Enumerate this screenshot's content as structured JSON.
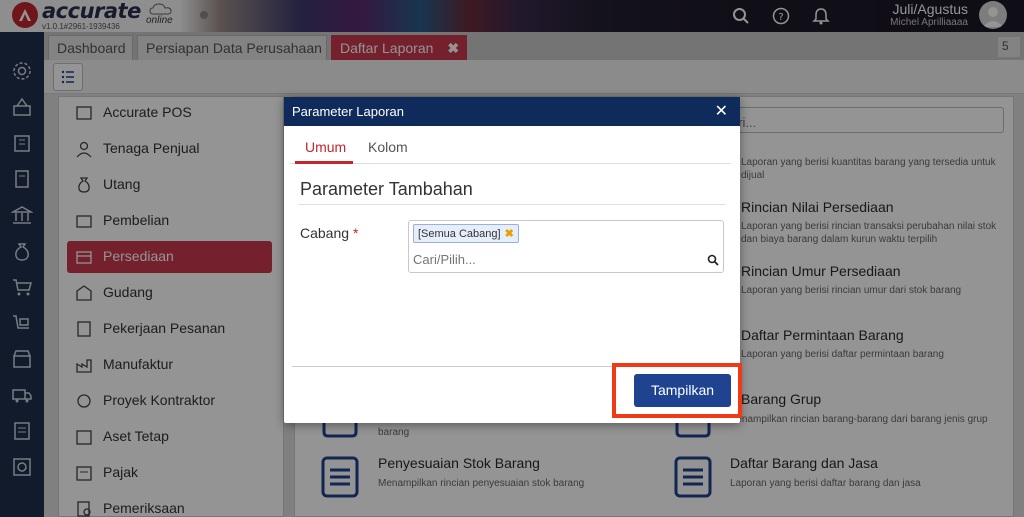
{
  "app": {
    "logo_text": "accurate",
    "logo_sub": "online",
    "version": "v1.0.1#2961-1939436"
  },
  "header": {
    "user_name": "Juli/Agustus",
    "user_sub": "Michel Aprilliaaaa"
  },
  "tabs": [
    {
      "label": "Dashboard"
    },
    {
      "label": "Persiapan Data Perusahaan"
    },
    {
      "label": "Daftar Laporan",
      "close": "✖"
    }
  ],
  "tab_count": "5",
  "nav": {
    "items": [
      {
        "label": "Accurate POS"
      },
      {
        "label": "Tenaga Penjual"
      },
      {
        "label": "Utang"
      },
      {
        "label": "Pembelian"
      },
      {
        "label": "Persediaan",
        "active": true
      },
      {
        "label": "Gudang"
      },
      {
        "label": "Pekerjaan Pesanan"
      },
      {
        "label": "Manufaktur"
      },
      {
        "label": "Proyek Kontraktor"
      },
      {
        "label": "Aset Tetap"
      },
      {
        "label": "Pajak"
      },
      {
        "label": "Pemeriksaan"
      }
    ]
  },
  "search": {
    "placeholder": "ari..."
  },
  "reports": [
    {
      "title": "",
      "desc": "Laporan yang berisi kuantitas barang yang tersedia untuk dijual"
    },
    {
      "title": "Rincian Nilai Persediaan",
      "desc": "Laporan yang berisi rincian transaksi perubahan nilai stok dan biaya barang dalam kurun waktu terpilih"
    },
    {
      "title": "Rincian Umur Persediaan",
      "desc": "Laporan yang berisi rincian umur dari stok barang"
    },
    {
      "title": "Daftar Permintaan Barang",
      "desc": "Laporan yang berisi daftar permintaan barang"
    },
    {
      "title": "Barang Grup",
      "desc": "Menampilkan rincian barang-barang dari barang jenis grup"
    },
    {
      "title": "Penyesuaian Stok Barang",
      "desc": "Menampilkan rincian penyesuaian stok barang"
    },
    {
      "title": "Daftar Barang dan Jasa",
      "desc": "Laporan yang berisi daftar barang dan jasa"
    },
    {
      "title": "",
      "desc": "barang"
    }
  ],
  "dialog": {
    "title": "Parameter Laporan",
    "close": "✕",
    "tabs": [
      {
        "label": "Umum"
      },
      {
        "label": "Kolom"
      }
    ],
    "section_title": "Parameter Tambahan",
    "field_label": "Cabang",
    "required_mark": "*",
    "chip_label": "[Semua Cabang]",
    "chip_remove": "✖",
    "input_placeholder": "Cari/Pilih...",
    "submit_label": "Tampilkan"
  },
  "colors": {
    "accent": "#c8384e",
    "dialog_header": "#0f2b5b",
    "primary_button": "#1f4391",
    "highlight": "#f03a17",
    "sidebar": "#1f2f4a"
  }
}
